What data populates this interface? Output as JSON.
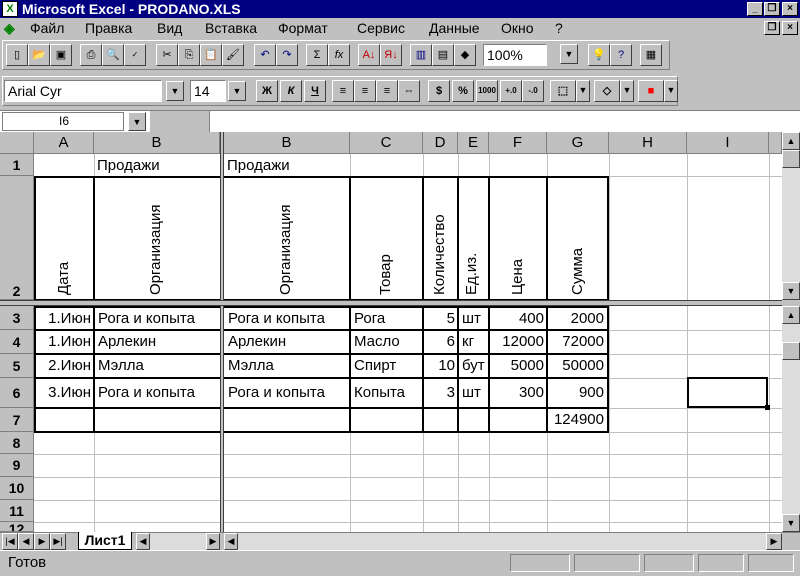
{
  "window": {
    "title": "Microsoft Excel - PRODANO.XLS"
  },
  "menu": [
    "Файл",
    "Правка",
    "Вид",
    "Вставка",
    "Формат",
    "Сервис",
    "Данные",
    "Окно",
    "?"
  ],
  "toolbar": {
    "zoom": "100%"
  },
  "format_bar": {
    "font": "Arial Cyr",
    "size": "14",
    "bold": "Ж",
    "italic": "К",
    "underline": "Ч",
    "percent": "%",
    "thousands": "1000"
  },
  "namebox": "I6",
  "columns": [
    "A",
    "B",
    "B",
    "C",
    "D",
    "E",
    "F",
    "G",
    "H",
    "I"
  ],
  "rows": [
    "1",
    "2",
    "3",
    "4",
    "5",
    "6",
    "7",
    "8",
    "9",
    "10",
    "11",
    "12"
  ],
  "sheet": {
    "title_left": "Продажи",
    "title_right": "Продажи",
    "headers": {
      "date": "Дата",
      "org": "Организация",
      "org2": "Организация",
      "product": "Товар",
      "qty": "Количество",
      "unit": "Ед.из.",
      "price": "Цена",
      "sum": "Сумма"
    },
    "data": [
      {
        "date": "1.Июн",
        "org": "Рога и копыта",
        "org2": "Рога и копыта",
        "product": "Рога",
        "qty": "5",
        "unit": "шт",
        "price": "400",
        "sum": "2000"
      },
      {
        "date": "1.Июн",
        "org": "Арлекин",
        "org2": "Арлекин",
        "product": "Масло",
        "qty": "6",
        "unit": "кг",
        "price": "12000",
        "sum": "72000"
      },
      {
        "date": "2.Июн",
        "org": "Мэлла",
        "org2": "Мэлла",
        "product": "Спирт",
        "qty": "10",
        "unit": "бут",
        "price": "5000",
        "sum": "50000"
      },
      {
        "date": "3.Июн",
        "org": "Рога и копыта",
        "org2": "Рога и копыта",
        "product": "Копыта",
        "qty": "3",
        "unit": "шт",
        "price": "300",
        "sum": "900"
      }
    ],
    "total": "124900"
  },
  "tab": "Лист1",
  "status": "Готов"
}
